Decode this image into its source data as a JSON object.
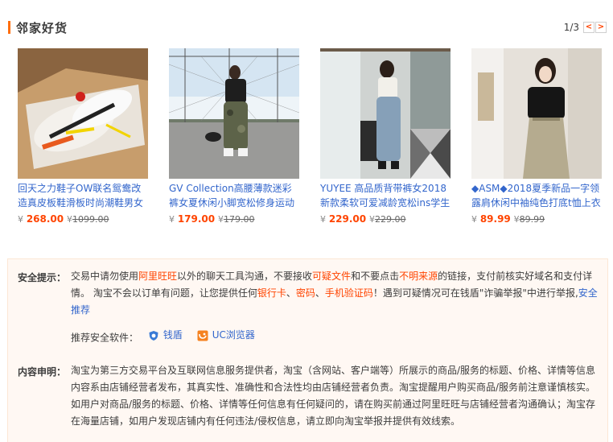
{
  "header": {
    "title": "邻家好货",
    "pager_text": "1/3",
    "prev_label": "<",
    "next_label": ">"
  },
  "products": [
    {
      "title": "回天之力鞋子OW联名鸳鸯改造真皮板鞋滑板时尚潮鞋男女",
      "currency": "¥",
      "price": "268.00",
      "currency_old": "¥",
      "old_price": "1099.00"
    },
    {
      "title": "GV Collection高腰薄款迷彩裤女夏休闲小脚宽松修身运动束",
      "currency": "¥",
      "price": "179.00",
      "currency_old": "¥",
      "old_price": "179.00"
    },
    {
      "title": "YUYEE 高品质背带裤女2018新款柔软可爱减龄宽松ins学生",
      "currency": "¥",
      "price": "229.00",
      "currency_old": "¥",
      "old_price": "229.00"
    },
    {
      "title": "◆ASM◆2018夏季新品一字领露肩休闲中袖纯色打底t恤上衣",
      "currency": "¥",
      "price": "89.99",
      "currency_old": "¥",
      "old_price": "89.99"
    }
  ],
  "notice": {
    "safety_label": "安全提示：",
    "safety_p1": "交易中请勿使用",
    "safety_aliww": "阿里旺旺",
    "safety_p2": "以外的聊天工具沟通，不要接收",
    "safety_suspicious": "可疑文件",
    "safety_p3": "和不要点击",
    "safety_unknown": "不明来源",
    "safety_p4": "的链接，支付前核实好域名和支付详情。 淘宝不会以订单有问题，让您提供任何",
    "safety_bankcard": "银行卡",
    "safety_sep1": "、",
    "safety_password": "密码",
    "safety_sep2": "、",
    "safety_smscode": "手机验证码",
    "safety_p5": "！遇到可疑情况可在钱盾\"诈骗举报\"中进行举报,",
    "safety_recommend_link": "安全推荐",
    "software_label": "推荐安全软件：",
    "software_1": "钱盾",
    "software_2": "UC浏览器",
    "content_label": "内容申明：",
    "content_text": "淘宝为第三方交易平台及互联网信息服务提供者，淘宝（含网站、客户端等）所展示的商品/服务的标题、价格、详情等信息内容系由店铺经营者发布，其真实性、准确性和合法性均由店铺经营者负责。淘宝提醒用户购买商品/服务前注意谨慎核实。如用户对商品/服务的标题、价格、详情等任何信息有任何疑问的，请在购买前通过阿里旺旺与店铺经营者沟通确认；淘宝存在海量店铺，如用户发现店铺内有任何违法/侵权信息，请立即向淘宝举报并提供有效线索。"
  },
  "colors": {
    "accent": "#ff4400",
    "link": "#3366cc",
    "title_bar": "#ff6f0f",
    "notice_bg": "#fff8f3"
  }
}
